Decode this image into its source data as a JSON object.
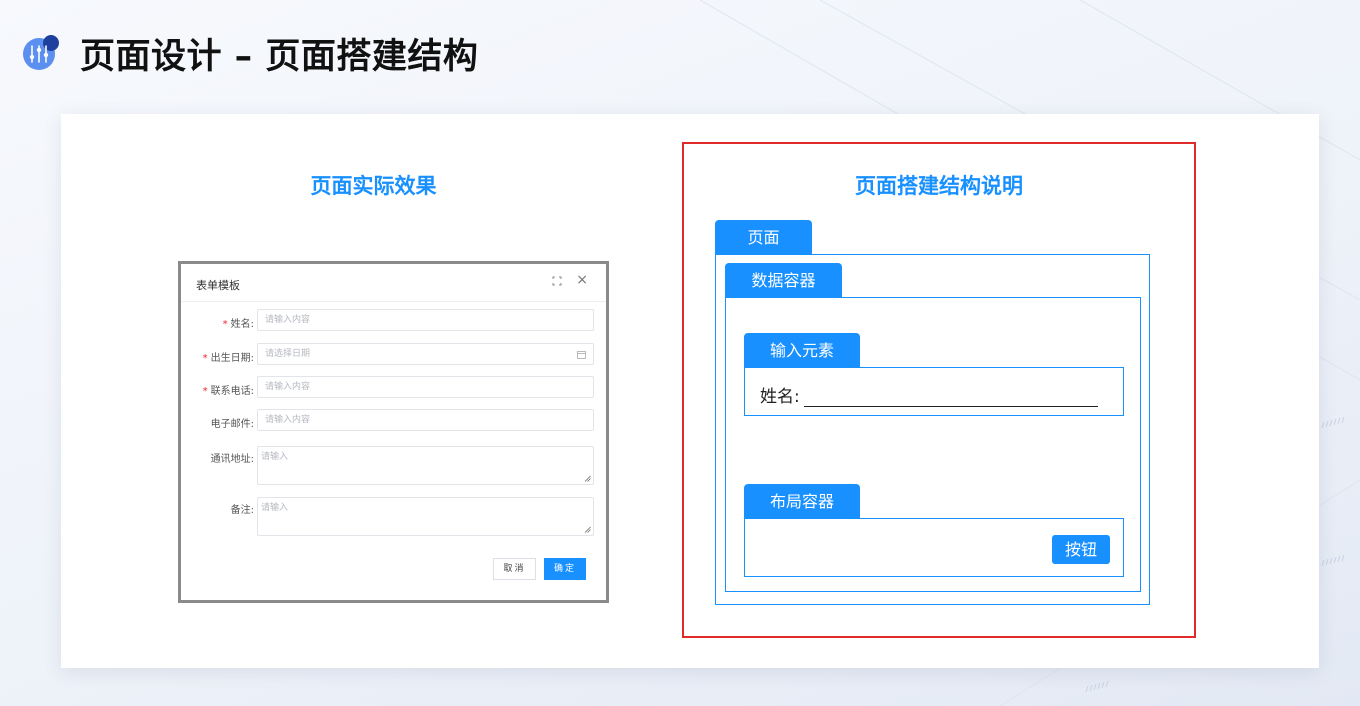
{
  "header": {
    "title": "页面设计 – 页面搭建结构",
    "icon": "sliders-icon"
  },
  "left_section": {
    "title": "页面实际效果",
    "form": {
      "title": "表单模板",
      "fields": [
        {
          "label": "姓名:",
          "required": true,
          "placeholder": "请输入内容"
        },
        {
          "label": "出生日期:",
          "required": true,
          "placeholder": "请选择日期"
        },
        {
          "label": "联系电话:",
          "required": true,
          "placeholder": "请输入内容"
        },
        {
          "label": "电子邮件:",
          "required": false,
          "placeholder": "请输入内容"
        },
        {
          "label": "通讯地址:",
          "required": false,
          "placeholder": "请输入"
        },
        {
          "label": "备注:",
          "required": false,
          "placeholder": "请输入"
        }
      ],
      "required_mark": "*",
      "close_glyph": "×",
      "cancel_label": "取消",
      "ok_label": "确定"
    }
  },
  "right_section": {
    "title": "页面搭建结构说明",
    "page_tab": "页面",
    "data_container_tab": "数据容器",
    "input_element_tab": "输入元素",
    "name_label": "姓名:",
    "layout_container_tab": "布局容器",
    "button_label": "按钮"
  },
  "colors": {
    "accent": "#1890ff",
    "highlight_frame": "#e02b2b",
    "required": "#f5222d"
  }
}
